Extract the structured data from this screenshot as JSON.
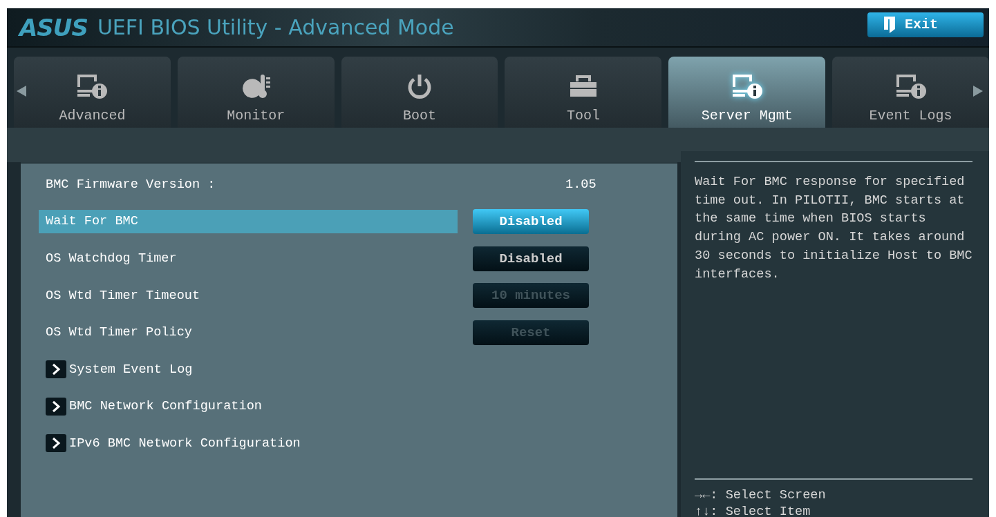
{
  "header": {
    "brand": "ASUS",
    "title": "UEFI BIOS Utility - Advanced Mode",
    "exit_button": "Exit"
  },
  "tabs": [
    {
      "label": "Advanced",
      "kind": "info",
      "selected": false
    },
    {
      "label": "Monitor",
      "kind": "monitor",
      "selected": false
    },
    {
      "label": "Boot",
      "kind": "boot",
      "selected": false
    },
    {
      "label": "Tool",
      "kind": "tool",
      "selected": false
    },
    {
      "label": "Server Mgmt",
      "kind": "info",
      "selected": true
    },
    {
      "label": "Event Logs",
      "kind": "info",
      "selected": false
    }
  ],
  "settings": [
    {
      "kind": "info",
      "label": "BMC Firmware Version :",
      "value": "1.05"
    },
    {
      "kind": "option",
      "label": "Wait For BMC",
      "value": "Disabled",
      "selected": true,
      "disabled": false
    },
    {
      "kind": "option",
      "label": "OS Watchdog Timer",
      "value": "Disabled",
      "selected": false,
      "disabled": false
    },
    {
      "kind": "option",
      "label": "OS Wtd Timer Timeout",
      "value": "10 minutes",
      "selected": false,
      "disabled": true
    },
    {
      "kind": "option",
      "label": "OS Wtd Timer Policy",
      "value": "Reset",
      "selected": false,
      "disabled": true
    },
    {
      "kind": "submenu",
      "label": "System Event Log"
    },
    {
      "kind": "submenu",
      "label": "BMC Network Configuration"
    },
    {
      "kind": "submenu",
      "label": "IPv6 BMC Network Configuration"
    }
  ],
  "help_text": "Wait For BMC response for specified time out. In PILOTII, BMC starts at the same time when BIOS starts during AC power ON. It takes around 30 seconds to initialize Host to BMC interfaces.",
  "key_hints": [
    "→←: Select Screen",
    "↑↓: Select Item"
  ]
}
